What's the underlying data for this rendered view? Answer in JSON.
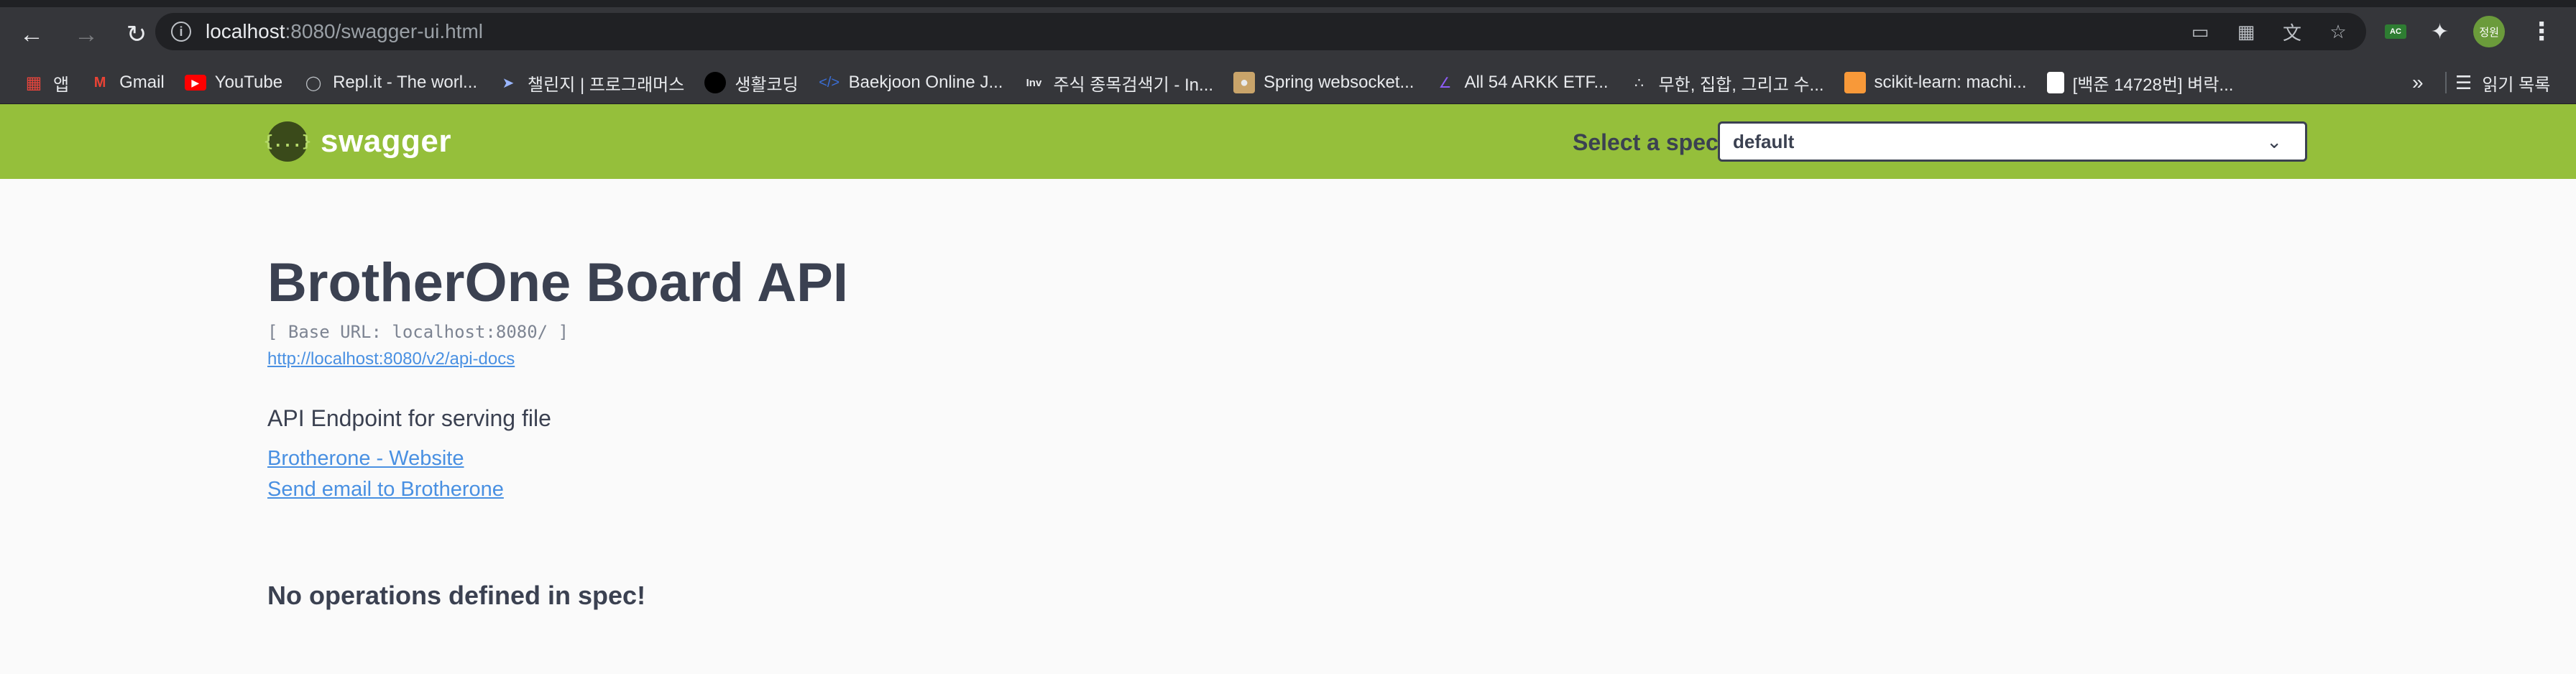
{
  "browser": {
    "url_host": "localhost",
    "url_rest": ":8080/swagger-ui.html",
    "bookmarks": [
      {
        "label": "앱",
        "icon": "apps-grid-icon"
      },
      {
        "label": "Gmail",
        "icon": "gmail-icon"
      },
      {
        "label": "YouTube",
        "icon": "youtube-icon"
      },
      {
        "label": "Repl.it - The worl...",
        "icon": "replit-icon"
      },
      {
        "label": "챌린지 | 프로그래머스",
        "icon": "programmers-icon"
      },
      {
        "label": "생활코딩",
        "icon": "opentutorials-icon"
      },
      {
        "label": "Baekjoon Online J...",
        "icon": "code-brackets-icon"
      },
      {
        "label": "주식 종목검색기 - In...",
        "icon": "investing-icon"
      },
      {
        "label": "Spring websocket...",
        "icon": "dog-icon"
      },
      {
        "label": "All 54 ARKK ETF...",
        "icon": "chart-icon"
      },
      {
        "label": "무한, 집합, 그리고 수...",
        "icon": "dots-icon"
      },
      {
        "label": "scikit-learn: machi...",
        "icon": "scikit-icon"
      },
      {
        "label": "[백준 14728번] 벼락...",
        "icon": "page-icon"
      }
    ],
    "more_label": "»",
    "reading_list_label": "읽기 목록",
    "avatar_text": "정원",
    "extension_badge": "AC"
  },
  "swagger": {
    "logo_mark": "{...}",
    "logo_text": "swagger",
    "select_spec_label": "Select a spec",
    "selected_spec": "default"
  },
  "info": {
    "title": "BrotherOne Board API",
    "base_url": "[ Base URL: localhost:8080/ ]",
    "api_docs_url": "http://localhost:8080/v2/api-docs",
    "description": "API Endpoint for serving file",
    "contact_website_label": "Brotherone - Website",
    "contact_email_label": "Send email to Brotherone"
  },
  "operations": {
    "empty_message": "No operations defined in spec!"
  },
  "colors": {
    "swagger_green": "#95bf3b",
    "link_blue": "#4990e2",
    "text_dark": "#3b4151",
    "chrome_dark": "#35363a"
  }
}
